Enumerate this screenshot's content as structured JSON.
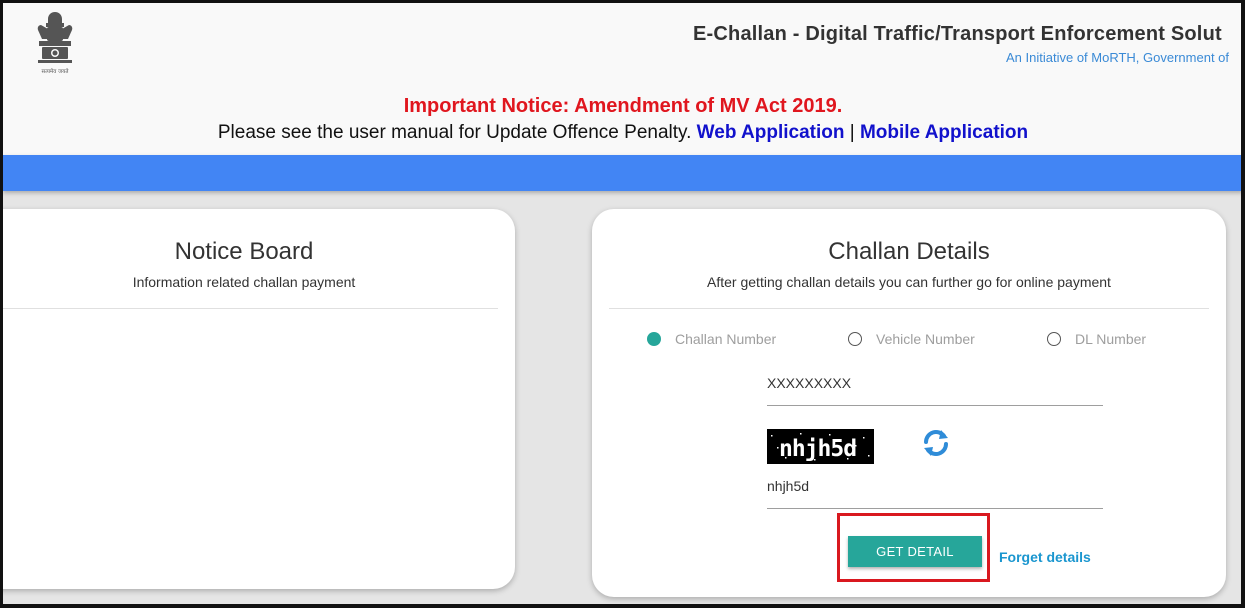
{
  "header": {
    "emblem_caption": "सत्यमेव जयते",
    "site_title": "E-Challan - Digital Traffic/Transport Enforcement Solut",
    "site_subtitle": "An Initiative of MoRTH, Government of",
    "notice_title": "Important Notice: Amendment of MV Act 2019.",
    "notice_text": "Please see the user manual for Update Offence Penalty.",
    "web_app_link": "Web Application",
    "separator": "|",
    "mobile_app_link": "Mobile Application"
  },
  "notice_board": {
    "title": "Notice Board",
    "description": "Information related challan payment"
  },
  "challan_details": {
    "title": "Challan Details",
    "description": "After getting challan details you can further go for online payment",
    "search_options": [
      {
        "label": "Challan Number",
        "checked": true
      },
      {
        "label": "Vehicle Number",
        "checked": false
      },
      {
        "label": "DL Number",
        "checked": false
      }
    ],
    "challan_input_value": "XXXXXXXXX",
    "captcha_text": "nhjh5d",
    "captcha_input_value": "nhjh5d",
    "submit_label": "GET DETAIL",
    "forget_link": "Forget details"
  },
  "colors": {
    "accent_blue": "#4285f4",
    "teal": "#26a69a",
    "notice_red": "#e0161e",
    "link_blue": "#1111cc",
    "highlight_red": "#d9181f"
  }
}
